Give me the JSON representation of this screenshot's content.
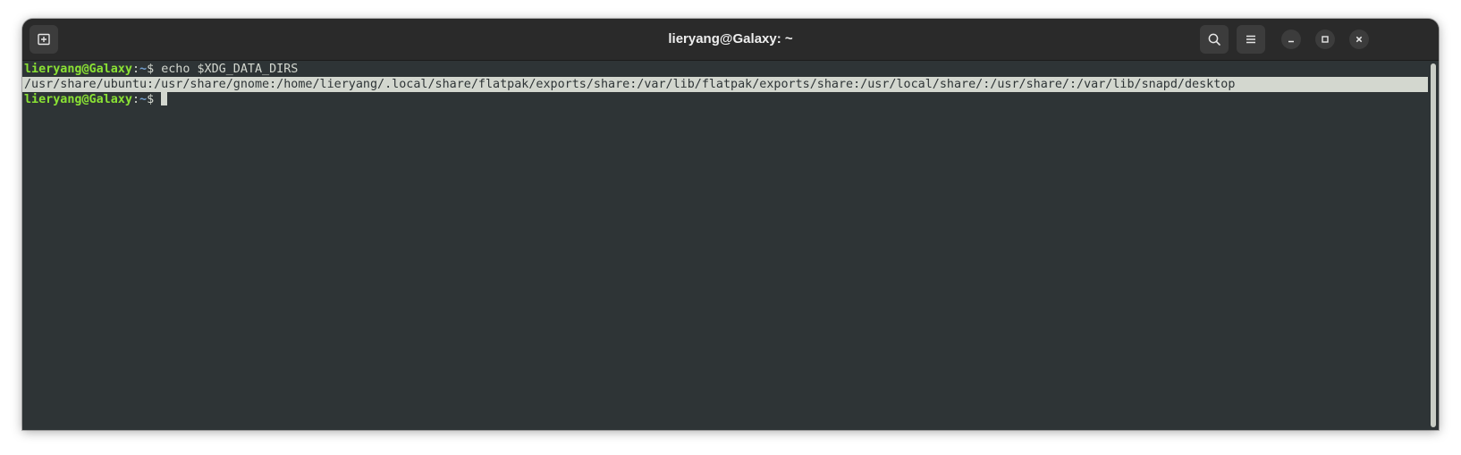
{
  "window": {
    "title": "lieryang@Galaxy: ~"
  },
  "icons": {
    "new_tab": "new-tab-icon",
    "search": "search-icon",
    "menu": "hamburger-menu-icon",
    "minimize": "minimize-icon",
    "maximize": "maximize-icon",
    "close": "close-icon"
  },
  "terminal": {
    "lines": [
      {
        "user_host": "lieryang@Galaxy",
        "separator": ":",
        "path": "~",
        "prompt": "$ ",
        "command": "echo $XDG_DATA_DIRS"
      },
      {
        "output": "/usr/share/ubuntu:/usr/share/gnome:/home/lieryang/.local/share/flatpak/exports/share:/var/lib/flatpak/exports/share:/usr/local/share/:/usr/share/:/var/lib/snapd/desktop"
      },
      {
        "user_host": "lieryang@Galaxy",
        "separator": ":",
        "path": "~",
        "prompt": "$ ",
        "command": ""
      }
    ]
  },
  "colors": {
    "background": "#2e3436",
    "foreground": "#d3d7cf",
    "prompt_user": "#8ae234",
    "prompt_path": "#729fcf",
    "titlebar": "#2a2a2a"
  }
}
